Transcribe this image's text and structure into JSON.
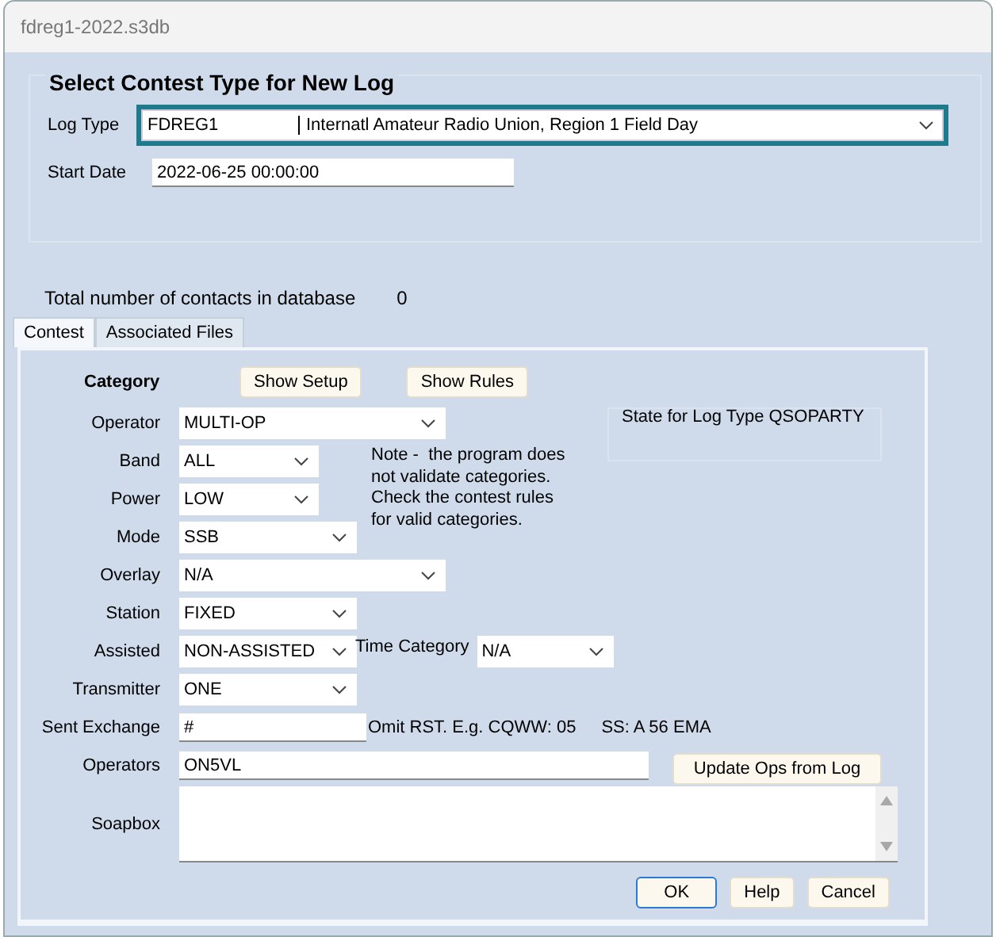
{
  "window": {
    "title": "fdreg1-2022.s3db"
  },
  "heading": "Select Contest Type for New Log",
  "log_type": {
    "label": "Log Type",
    "code": "FDREG1",
    "description": "Internatl Amateur Radio Union, Region 1 Field Day"
  },
  "start_date": {
    "label": "Start Date",
    "value": "2022-06-25 00:00:00"
  },
  "contacts": {
    "label": "Total number of contacts in database",
    "value": "0"
  },
  "tabs": [
    {
      "label": "Contest",
      "selected": true
    },
    {
      "label": "Associated Files",
      "selected": false
    }
  ],
  "category": {
    "label": "Category",
    "buttons": [
      "Show Setup",
      "Show Rules"
    ]
  },
  "fields": [
    {
      "kind": "select",
      "label": "Operator",
      "value": "MULTI-OP"
    },
    {
      "kind": "select",
      "label": "Band",
      "value": "ALL"
    },
    {
      "kind": "select",
      "label": "Power",
      "value": "LOW"
    },
    {
      "kind": "select",
      "label": "Mode",
      "value": "SSB"
    },
    {
      "kind": "select",
      "label": "Overlay",
      "value": "N/A"
    },
    {
      "kind": "select",
      "label": "Station",
      "value": "FIXED"
    },
    {
      "kind": "select",
      "label": "Assisted",
      "value": "NON-ASSISTED",
      "extra": {
        "label": "Time Category",
        "value": "N/A"
      }
    },
    {
      "kind": "select",
      "label": "Transmitter",
      "value": "ONE"
    },
    {
      "kind": "input",
      "label": "Sent Exchange",
      "value": "#",
      "hints": [
        "Omit RST. E.g. CQWW: 05",
        "SS: A 56 EMA"
      ]
    },
    {
      "kind": "input",
      "label": "Operators",
      "value": "ON5VL",
      "button": "Update Ops from Log"
    },
    {
      "kind": "textarea",
      "label": "Soapbox"
    }
  ],
  "note": [
    "Note -  the program does",
    "not validate categories.",
    "Check the contest rules",
    "for valid categories."
  ],
  "state_box": {
    "label": "State for Log Type QSOPARTY"
  },
  "buttons": [
    {
      "label": "OK",
      "default": true
    },
    {
      "label": "Help",
      "default": false
    },
    {
      "label": "Cancel",
      "default": false
    }
  ]
}
